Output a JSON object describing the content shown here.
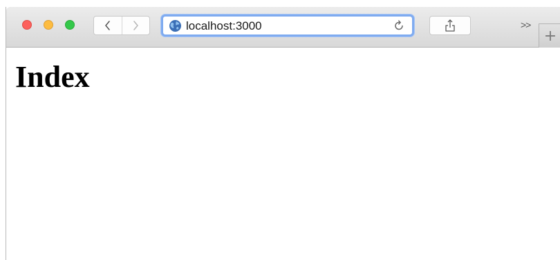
{
  "browser": {
    "url": "localhost:3000",
    "more_label": ">>",
    "new_tab_label": "+",
    "icons": {
      "back": "chevron-left-icon",
      "forward": "chevron-right-icon",
      "site": "globe-icon",
      "reload": "reload-icon",
      "share": "share-icon"
    },
    "colors": {
      "close": "#fc605c",
      "minimize": "#fdbc40",
      "maximize": "#34c84a",
      "address_focus": "#7fabf0"
    }
  },
  "page": {
    "heading": "Index"
  }
}
